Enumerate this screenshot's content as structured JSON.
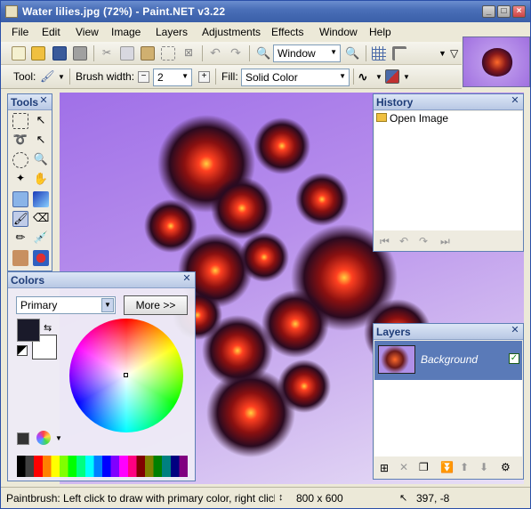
{
  "window": {
    "title": "Water lilies.jpg (72%) - Paint.NET v3.22"
  },
  "menu": [
    "File",
    "Edit",
    "View",
    "Image",
    "Layers",
    "Adjustments",
    "Effects",
    "Window",
    "Help"
  ],
  "toolbar": {
    "zoom_value": "Window",
    "tool_label": "Tool:",
    "brush_width_label": "Brush width:",
    "brush_width_value": "2",
    "fill_label": "Fill:",
    "fill_value": "Solid Color"
  },
  "tools_panel": {
    "title": "Tools"
  },
  "history_panel": {
    "title": "History",
    "items": [
      "Open Image"
    ]
  },
  "colors_panel": {
    "title": "Colors",
    "mode_value": "Primary",
    "more_button": "More >>"
  },
  "layers_panel": {
    "title": "Layers",
    "layers": [
      {
        "name": "Background",
        "visible": true
      }
    ]
  },
  "status": {
    "hint": "Paintbrush: Left click to draw with primary color, right click to d",
    "image_size": "800 x 600",
    "cursor_pos": "397, -8"
  },
  "colors": {
    "titlebar": "#3a5fa8",
    "panel_border": "#5e7fb5",
    "primary_color": "#1a1a2a",
    "secondary_color": "#ffffff"
  }
}
